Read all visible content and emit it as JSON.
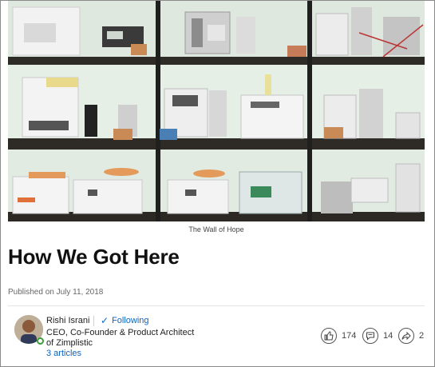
{
  "hero": {
    "caption": "The Wall of Hope"
  },
  "article": {
    "title": "How We Got Here",
    "published": "Published on July 11, 2018"
  },
  "author": {
    "name": "Rishi Israni",
    "follow_label": "Following",
    "title": "CEO, Co-Founder & Product Architect of Zimplistic",
    "articles": "3 articles"
  },
  "social": {
    "likes": "174",
    "comments": "14",
    "shares": "2"
  },
  "colors": {
    "link": "#0a66c2",
    "online": "#3c9e3c"
  }
}
